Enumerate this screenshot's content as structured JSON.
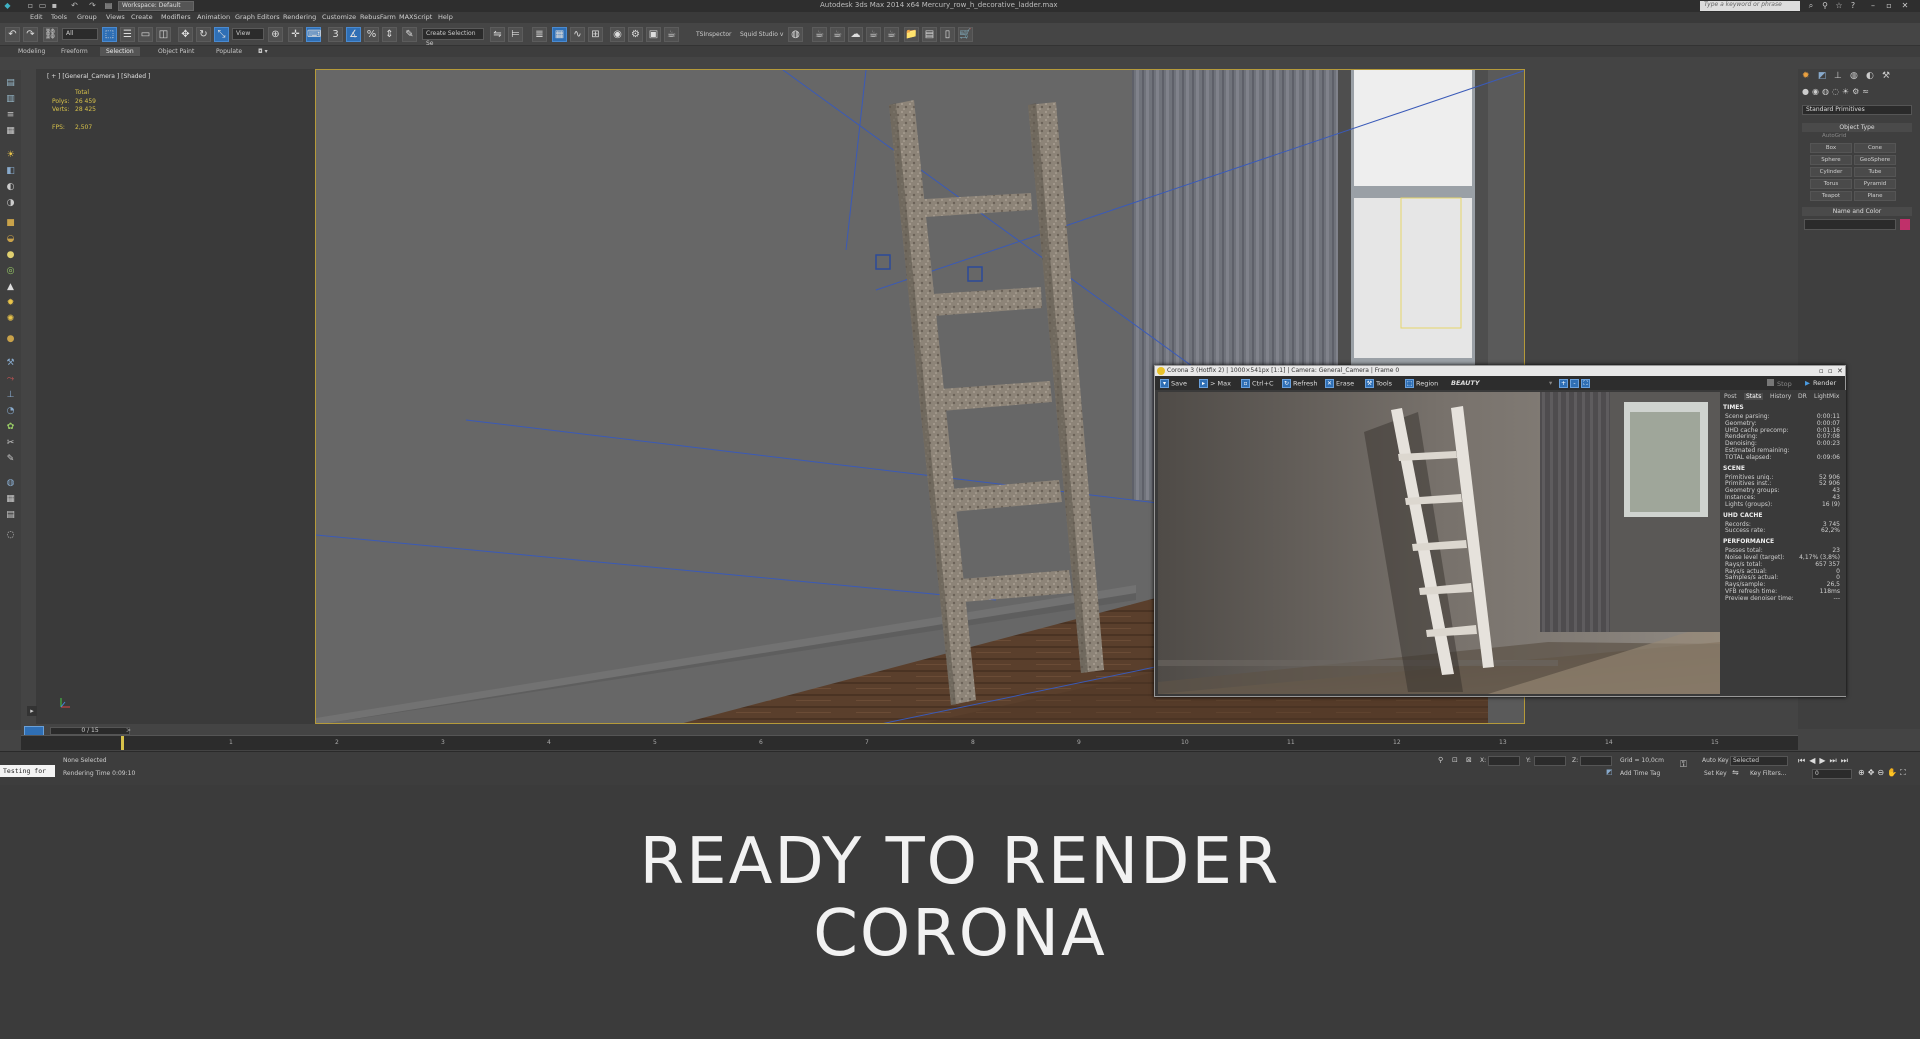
{
  "window": {
    "title": "Autodesk 3ds Max  2014 x64    Mercury_row_h_decorative_ladder.max",
    "workspace": "Workspace: Default",
    "search_placeholder": "Type a keyword or phrase"
  },
  "menu": [
    "Edit",
    "Tools",
    "Group",
    "Views",
    "Create",
    "Modifiers",
    "Animation",
    "Graph Editors",
    "Rendering",
    "Customize",
    "RebusFarm",
    "MAXScript",
    "Help"
  ],
  "toolbar": {
    "filter": "All",
    "ref_coord": "View",
    "selection_set": "Create Selection Se",
    "tsinspector": "TSInspector",
    "squid": "Squid Studio v"
  },
  "ribbon_tabs": [
    "Modeling",
    "Freeform",
    "Selection",
    "Object Paint",
    "Populate"
  ],
  "ribbon_active": "Selection",
  "viewport": {
    "label": "[ + ] [General_Camera ] [Shaded ]",
    "stats_header": "Total",
    "polys_label": "Polys:",
    "polys_value": "26 459",
    "verts_label": "Verts:",
    "verts_value": "28 425",
    "fps_label": "FPS:",
    "fps_value": "2,507"
  },
  "command_panel": {
    "dropdown": "Standard Primitives",
    "object_type": "Object Type",
    "autogrid": "AutoGrid",
    "buttons": [
      "Box",
      "Cone",
      "Sphere",
      "GeoSphere",
      "Cylinder",
      "Tube",
      "Torus",
      "Pyramid",
      "Teapot",
      "Plane"
    ],
    "name_color": "Name and Color",
    "color": "#c0306a"
  },
  "timeline": {
    "frame": "0 / 15",
    "ticks": [
      "1",
      "2",
      "3",
      "4",
      "5",
      "6",
      "7",
      "8",
      "9",
      "10",
      "11",
      "12",
      "13",
      "14",
      "15"
    ]
  },
  "status": {
    "script": "Testing for",
    "selection": "None Selected",
    "render_time": "Rendering Time  0:09:10",
    "x_label": "X:",
    "y_label": "Y:",
    "z_label": "Z:",
    "grid": "Grid = 10,0cm",
    "add_time_tag": "Add Time Tag",
    "auto_key": "Auto Key",
    "set_key": "Set Key",
    "selected": "Selected",
    "key_filters": "Key Filters...",
    "frame_field": "0"
  },
  "vfb": {
    "title": "Corona 3 (Hotfix 2) | 1000×541px [1:1] | Camera: General_Camera | Frame 0",
    "buttons": [
      "Save",
      "> Max",
      "Ctrl+C",
      "Refresh",
      "Erase",
      "Tools",
      "Region"
    ],
    "pass": "BEAUTY",
    "stop": "Stop",
    "render": "Render",
    "tabs": [
      "Post",
      "Stats",
      "History",
      "DR",
      "LightMix"
    ],
    "active_tab": "Stats",
    "sections": [
      {
        "title": "TIMES",
        "rows": [
          [
            "Scene parsing:",
            "0:00:11"
          ],
          [
            "Geometry:",
            "0:00:07"
          ],
          [
            "UHD cache precomp:",
            "0:01:16"
          ],
          [
            "Rendering:",
            "0:07:08"
          ],
          [
            "Denoising:",
            "0:00:23"
          ],
          [
            "Estimated remaining:",
            ""
          ],
          [
            "TOTAL elapsed:",
            "0:09:06"
          ]
        ]
      },
      {
        "title": "SCENE",
        "rows": [
          [
            "Primitives uniq.:",
            "52 906"
          ],
          [
            "Primitives inst.:",
            "52 906"
          ],
          [
            "Geometry groups:",
            "43"
          ],
          [
            "Instances:",
            "43"
          ],
          [
            "Lights (groups):",
            "16 (9)"
          ]
        ]
      },
      {
        "title": "UHD CACHE",
        "rows": [
          [
            "Records:",
            "3 745"
          ],
          [
            "Success rate:",
            "62,2%"
          ]
        ]
      },
      {
        "title": "PERFORMANCE",
        "rows": [
          [
            "Passes total:",
            "23"
          ],
          [
            "Noise level (target):",
            "4,17% (3,8%)"
          ],
          [
            "Rays/s total:",
            "657 357"
          ],
          [
            "Rays/s actual:",
            "0"
          ],
          [
            "Samples/s actual:",
            "0"
          ],
          [
            "Rays/sample:",
            "26,5"
          ],
          [
            "VFB refresh time:",
            "118ms"
          ],
          [
            "Preview denoiser time:",
            "---"
          ]
        ]
      }
    ]
  },
  "caption": {
    "line1": "READY TO RENDER",
    "line2": "CORONA"
  }
}
